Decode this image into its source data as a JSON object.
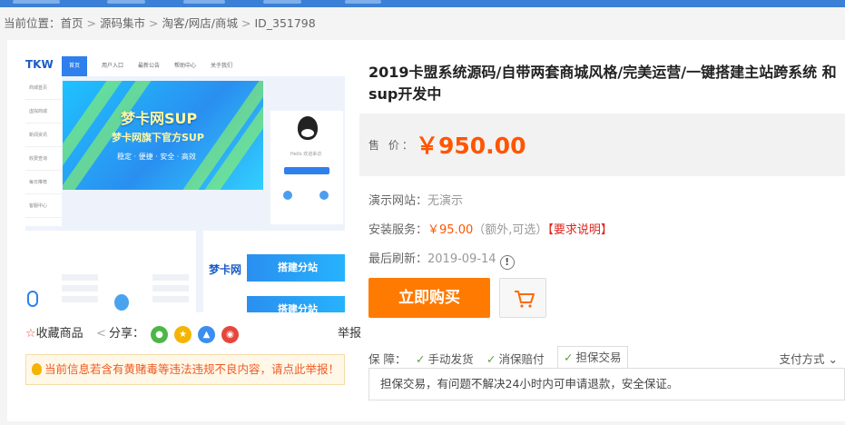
{
  "breadcrumb": {
    "prefix": "当前位置：",
    "items": [
      "首页",
      "源码集市",
      "淘客/网店/商城",
      "ID_351798"
    ]
  },
  "gallery": {
    "nav_items": [
      "首页",
      "用户入口",
      "最新公告",
      "帮助中心",
      "关于我们"
    ],
    "sidebar_items": [
      "商城首页",
      "虚拟商城",
      "新闻资讯",
      "收费查询",
      "每日推荐",
      "客服中心"
    ],
    "banner_title": "梦卡网SUP",
    "banner_sub": "梦卡网旗下官方SUP",
    "banner_tags": "稳定 · 便捷 · 安全 · 高效",
    "panel_hello": "Hello 欢迎来访",
    "lower_ad_logo": "梦卡网",
    "lower_ad_1": "搭建分站",
    "lower_ad_2": "搭建分站"
  },
  "actions": {
    "favorite": "收藏商品",
    "share_label": "分享：",
    "report": "举报"
  },
  "notice": "当前信息若含有黄赌毒等违法违规不良内容，请点此举报！",
  "product": {
    "title": "2019卡盟系统源码/自带两套商城风格/完美运营/一键搭建主站跨系统 和sup开发中",
    "price_label": "售 价：",
    "price": "￥950.00",
    "demo_label": "演示网站：",
    "demo_value": "无演示",
    "install_label": "安装服务：",
    "install_price": "￥95.00",
    "install_note": "（额外,可选）",
    "install_link": "【要求说明】",
    "refresh_label": "最后刷新：",
    "refresh_date": "2019-09-14",
    "buy_button": "立即购买"
  },
  "guarantee": {
    "label": "保 障：",
    "tags": [
      "手动发货",
      "消保赔付",
      "担保交易"
    ],
    "payment": "支付方式",
    "description": "担保交易，有问题不解决24小时内可申请退款，安全保证。"
  },
  "colors": {
    "accent": "#ff7a00",
    "price": "#ff5500",
    "top_bar": "#3c7fd6"
  },
  "icons": [
    "star-icon",
    "share-icon",
    "wechat-icon",
    "qzone-icon",
    "qq-icon",
    "weibo-icon",
    "bulb-icon",
    "info-icon",
    "cart-icon",
    "check-icon",
    "chevron-down-icon"
  ]
}
